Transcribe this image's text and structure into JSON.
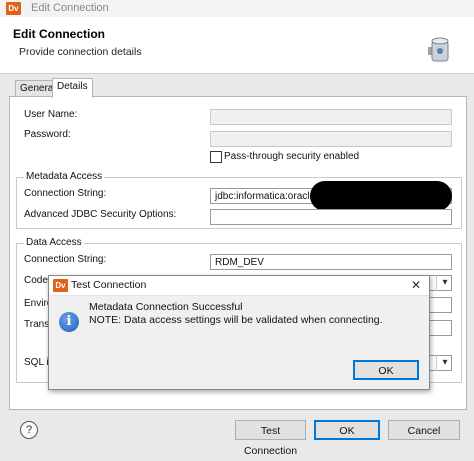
{
  "window": {
    "title": "Edit Connection",
    "app_icon_text": "Dv",
    "header_title": "Edit Connection",
    "header_subtitle": "Provide connection details",
    "header_icon": "database-plug-icon"
  },
  "tabs": [
    {
      "label": "General"
    },
    {
      "label": "Details"
    }
  ],
  "details": {
    "user_name_label": "User Name:",
    "user_name_value": "",
    "password_label": "Password:",
    "password_value": "",
    "passthrough_label": "Pass-through security enabled",
    "passthrough_checked": false,
    "metadata_access": {
      "group_label": "Metadata Access",
      "connection_string_label": "Connection String:",
      "connection_string_value": "jdbc:informatica:oracle:",
      "advanced_jdbc_label": "Advanced JDBC Security Options:",
      "advanced_jdbc_value": ""
    },
    "data_access": {
      "group_label": "Data Access",
      "connection_string_label": "Connection String:",
      "connection_string_value": "RDM_DEV",
      "code_label_partial": "Code",
      "envir_label_partial": "Enviro",
      "trans_label_partial": "Transa",
      "sql_label_partial": "SQL id"
    }
  },
  "buttons": {
    "help_icon": "help-icon",
    "test_connection": "Test Connection",
    "ok": "OK",
    "cancel": "Cancel"
  },
  "dialog": {
    "title": "Test Connection",
    "app_icon_text": "Dv",
    "close_glyph": "✕",
    "icon": "info-icon",
    "line1": "Metadata Connection Successful",
    "line2": "NOTE: Data access settings will be validated when connecting.",
    "ok": "OK"
  },
  "colors": {
    "accent": "#0078d7",
    "app_icon": "#e2611a",
    "info_icon": "#1b5bbd"
  }
}
